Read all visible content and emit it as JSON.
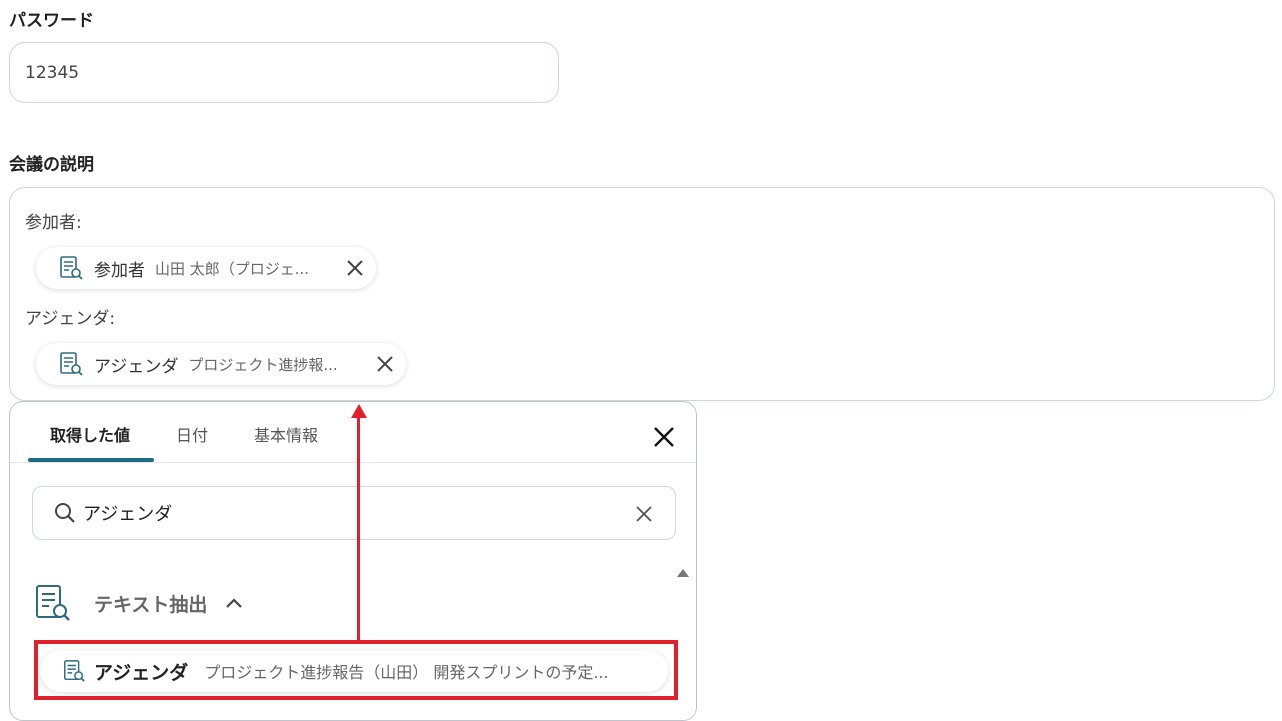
{
  "password": {
    "label": "パスワード",
    "value": "12345"
  },
  "description": {
    "label": "会議の説明",
    "line1": "参加者:",
    "chip1": {
      "title": "参加者",
      "value": "山田 太郎（プロジェ..."
    },
    "line2": "アジェンダ:",
    "chip2": {
      "title": "アジェンダ",
      "value": "プロジェクト進捗報..."
    }
  },
  "picker": {
    "tabs": [
      "取得した値",
      "日付",
      "基本情報"
    ],
    "active_tab": "取得した値",
    "search": {
      "value": "アジェンダ"
    },
    "section": {
      "title": "テキスト抽出"
    },
    "result": {
      "title": "アジェンダ",
      "value": "プロジェクト進捗報告（山田） 開発スプリントの予定..."
    }
  },
  "colors": {
    "accent": "#1d6b80",
    "icon": "#2b6d7e",
    "highlight": "#e0202a"
  },
  "icons": {
    "chip": "document-search-icon",
    "close": "close-icon",
    "search": "search-icon",
    "section": "document-search-icon",
    "collapse": "chevron-up-icon"
  }
}
